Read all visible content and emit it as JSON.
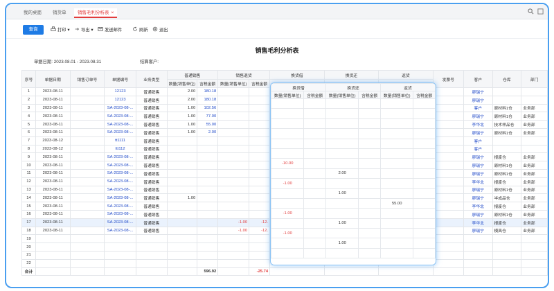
{
  "tabs": [
    {
      "label": "我的桌面"
    },
    {
      "label": "销货单"
    },
    {
      "label": "销售毛利分析表"
    }
  ],
  "toolbar": {
    "query": "查询",
    "print": "打印",
    "export": "导出",
    "send_email": "发送邮件",
    "refresh": "刷新",
    "exit": "退出"
  },
  "report": {
    "title": "销售毛利分析表",
    "date_label": "单据日期:",
    "date_value": "2023.08.01 - 2023.08.31",
    "customer_label": "结算客户:"
  },
  "columns": {
    "seq": "序号",
    "date": "单据日期",
    "order_no": "销售订单号",
    "doc_no": "单据编号",
    "biz_type": "业务类型",
    "normal_sales": "普通销售",
    "sales_return": "销售退货",
    "exchange_out": "换货借",
    "exchange_in": "换货还",
    "return_goods": "返货",
    "invoice_no": "发票号",
    "customer": "客户",
    "warehouse": "仓库",
    "dept": "部门",
    "qty": "数量(销售单位)",
    "amount": "含税金额"
  },
  "rows": [
    {
      "seq": "1",
      "date": "2023-08-11",
      "doc": "12123",
      "type": "普通销售",
      "ns_qty": "2.00",
      "ns_amt": "180.18",
      "sr_qty": "",
      "sr_amt": "",
      "customer": "廖瑞宁",
      "wh": "",
      "dept": ""
    },
    {
      "seq": "2",
      "date": "2023-08-11",
      "doc": "12123",
      "type": "普通销售",
      "ns_qty": "2.00",
      "ns_amt": "180.18",
      "sr_qty": "",
      "sr_amt": "",
      "customer": "廖瑞宁",
      "wh": "",
      "dept": ""
    },
    {
      "seq": "3",
      "date": "2023-08-11",
      "doc": "SA-2023-08-...",
      "type": "普通销售",
      "ns_qty": "1.00",
      "ns_amt": "102.56",
      "sr_qty": "",
      "sr_amt": "",
      "customer": "客户",
      "wh": "原材料1仓",
      "dept": "业务部"
    },
    {
      "seq": "4",
      "date": "2023-08-11",
      "doc": "SA-2023-08-...",
      "type": "普通销售",
      "ns_qty": "1.00",
      "ns_amt": "77.00",
      "sr_qty": "",
      "sr_amt": "",
      "customer": "廖瑞宁",
      "wh": "原材料1仓",
      "dept": "业务部"
    },
    {
      "seq": "5",
      "date": "2023-08-11",
      "doc": "SA-2023-08-...",
      "type": "普通销售",
      "ns_qty": "1.00",
      "ns_amt": "55.00",
      "sr_qty": "",
      "sr_amt": "",
      "customer": "李华北",
      "wh": "技术样品仓",
      "dept": "业务部"
    },
    {
      "seq": "6",
      "date": "2023-08-11",
      "doc": "SA-2023-08-...",
      "type": "普通销售",
      "ns_qty": "1.00",
      "ns_amt": "2.00",
      "sr_qty": "",
      "sr_amt": "",
      "customer": "廖瑞宁",
      "wh": "原材料1仓",
      "dept": "业务部"
    },
    {
      "seq": "7",
      "date": "2023-08-12",
      "doc": "tt1111",
      "type": "普通销售",
      "ns_qty": "",
      "ns_amt": "",
      "sr_qty": "",
      "sr_amt": "",
      "customer": "客户",
      "wh": "",
      "dept": ""
    },
    {
      "seq": "8",
      "date": "2023-08-12",
      "doc": "ttt112",
      "type": "普通销售",
      "ns_qty": "",
      "ns_amt": "",
      "sr_qty": "",
      "sr_amt": "",
      "customer": "客户",
      "wh": "",
      "dept": ""
    },
    {
      "seq": "9",
      "date": "2023-08-11",
      "doc": "SA-2023-08-...",
      "type": "普通销售",
      "ns_qty": "",
      "ns_amt": "",
      "sr_qty": "",
      "sr_amt": "",
      "customer": "廖瑞宁",
      "wh": "报废仓",
      "dept": "业务部"
    },
    {
      "seq": "10",
      "date": "2023-08-11",
      "doc": "SA-2023-08-...",
      "type": "普通销售",
      "ns_qty": "",
      "ns_amt": "",
      "sr_qty": "",
      "sr_amt": "",
      "customer": "廖瑞宁",
      "wh": "原材料1仓",
      "dept": "业务部"
    },
    {
      "seq": "11",
      "date": "2023-08-11",
      "doc": "SA-2023-08-...",
      "type": "普通销售",
      "ns_qty": "",
      "ns_amt": "",
      "sr_qty": "",
      "sr_amt": "",
      "customer": "廖瑞宁",
      "wh": "原材料1仓",
      "dept": "业务部"
    },
    {
      "seq": "12",
      "date": "2023-08-11",
      "doc": "SA-2023-08-...",
      "type": "普通销售",
      "ns_qty": "",
      "ns_amt": "",
      "sr_qty": "",
      "sr_amt": "",
      "customer": "李华北",
      "wh": "报废仓",
      "dept": "业务部"
    },
    {
      "seq": "13",
      "date": "2023-08-11",
      "doc": "SA-2023-08-...",
      "type": "普通销售",
      "ns_qty": "",
      "ns_amt": "",
      "sr_qty": "",
      "sr_amt": "",
      "customer": "廖瑞宁",
      "wh": "原材料1仓",
      "dept": "业务部"
    },
    {
      "seq": "14",
      "date": "2023-08-11",
      "doc": "SA-2023-08-...",
      "type": "普通销售",
      "ns_qty": "1.00",
      "ns_amt": "",
      "sr_qty": "",
      "sr_amt": "",
      "customer": "廖瑞宁",
      "wh": "半成品仓",
      "dept": "业务部"
    },
    {
      "seq": "15",
      "date": "2023-08-11",
      "doc": "SA-2023-08-...",
      "type": "普通销售",
      "ns_qty": "",
      "ns_amt": "",
      "sr_qty": "",
      "sr_amt": "",
      "customer": "李华北",
      "wh": "报废仓",
      "dept": "业务部"
    },
    {
      "seq": "16",
      "date": "2023-08-11",
      "doc": "SA-2023-08-...",
      "type": "普通销售",
      "ns_qty": "",
      "ns_amt": "",
      "sr_qty": "",
      "sr_amt": "",
      "customer": "廖瑞宁",
      "wh": "原材料1仓",
      "dept": "业务部"
    },
    {
      "seq": "17",
      "date": "2023-08-11",
      "doc": "SA-2023-08-...",
      "type": "普通销售",
      "ns_qty": "",
      "ns_amt": "",
      "sr_qty": "-1.00",
      "sr_amt": "-12.",
      "customer": "李华北",
      "wh": "报废仓",
      "dept": "业务部"
    },
    {
      "seq": "18",
      "date": "2023-08-11",
      "doc": "SA-2023-08-...",
      "type": "普通销售",
      "ns_qty": "",
      "ns_amt": "",
      "sr_qty": "-1.00",
      "sr_amt": "-12.",
      "customer": "廖瑞宁",
      "wh": "模具仓",
      "dept": "业务部"
    },
    {
      "seq": "19",
      "date": "",
      "doc": "",
      "type": "",
      "ns_qty": "",
      "ns_amt": "",
      "sr_qty": "",
      "sr_amt": "",
      "customer": "",
      "wh": "",
      "dept": ""
    },
    {
      "seq": "20",
      "date": "",
      "doc": "",
      "type": "",
      "ns_qty": "",
      "ns_amt": "",
      "sr_qty": "",
      "sr_amt": "",
      "customer": "",
      "wh": "",
      "dept": ""
    },
    {
      "seq": "21",
      "date": "",
      "doc": "",
      "type": "",
      "ns_qty": "",
      "ns_amt": "",
      "sr_qty": "",
      "sr_amt": "",
      "customer": "",
      "wh": "",
      "dept": ""
    },
    {
      "seq": "22",
      "date": "",
      "doc": "",
      "type": "",
      "ns_qty": "",
      "ns_amt": "",
      "sr_qty": "",
      "sr_amt": "",
      "customer": "",
      "wh": "",
      "dept": ""
    }
  ],
  "total": {
    "label": "合计",
    "ns_amt": "596.92",
    "sr_amt": "-25.74"
  },
  "overlay": {
    "groups": [
      "换货借",
      "换货还",
      "返货"
    ],
    "qty": "数量(销售单位)",
    "amount": "含税金额",
    "rows": [
      [
        "",
        "",
        "",
        "",
        "",
        ""
      ],
      [
        "",
        "",
        "",
        "",
        "",
        ""
      ],
      [
        "",
        "",
        "",
        "",
        "",
        ""
      ],
      [
        "",
        "",
        "",
        "",
        "",
        ""
      ],
      [
        "",
        "",
        "",
        "",
        "",
        ""
      ],
      [
        "",
        "",
        "",
        "",
        "",
        ""
      ],
      [
        "-10.00",
        "",
        "",
        "",
        "",
        ""
      ],
      [
        "",
        "",
        "2.00",
        "",
        "",
        ""
      ],
      [
        "-1.00",
        "",
        "",
        "",
        "",
        ""
      ],
      [
        "",
        "",
        "1.00",
        "",
        "",
        ""
      ],
      [
        "",
        "",
        "",
        "",
        "55.00",
        ""
      ],
      [
        "-1.00",
        "",
        "",
        "",
        "",
        ""
      ],
      [
        "",
        "",
        "1.00",
        "",
        "",
        ""
      ],
      [
        "-1.00",
        "",
        "",
        "",
        "",
        ""
      ],
      [
        "",
        "",
        "1.00",
        "",
        "",
        ""
      ],
      [
        "",
        "",
        "",
        "",
        "",
        ""
      ]
    ]
  },
  "colors": {
    "accent": "#1e7be5",
    "danger": "#e23b3b",
    "link": "#1f49c8",
    "frame": "#4a9ff0"
  }
}
